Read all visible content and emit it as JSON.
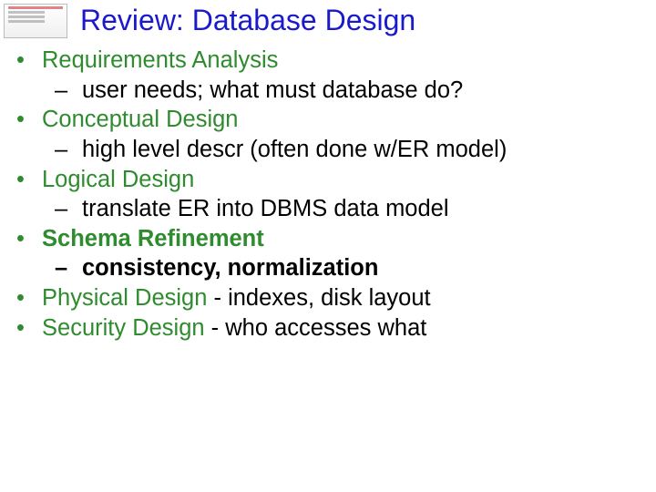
{
  "title": "Review: Database Design",
  "items": [
    {
      "label": "Requirements Analysis",
      "bold": false,
      "sub": {
        "text": "user needs; what must database do?",
        "bold": false
      }
    },
    {
      "label": "Conceptual Design",
      "bold": false,
      "sub": {
        "text": "high level descr (often done w/ER model)",
        "bold": false
      }
    },
    {
      "label": "Logical Design",
      "bold": false,
      "sub": {
        "text": "translate ER into DBMS data model",
        "bold": false
      }
    },
    {
      "label": "Schema Refinement",
      "bold": true,
      "sub": {
        "text": "consistency, normalization",
        "bold": true
      }
    },
    {
      "label": "Physical Design",
      "tail": " - indexes, disk layout",
      "bold": false
    },
    {
      "label": "Security Design",
      "tail": " - who accesses what",
      "bold": false
    }
  ]
}
